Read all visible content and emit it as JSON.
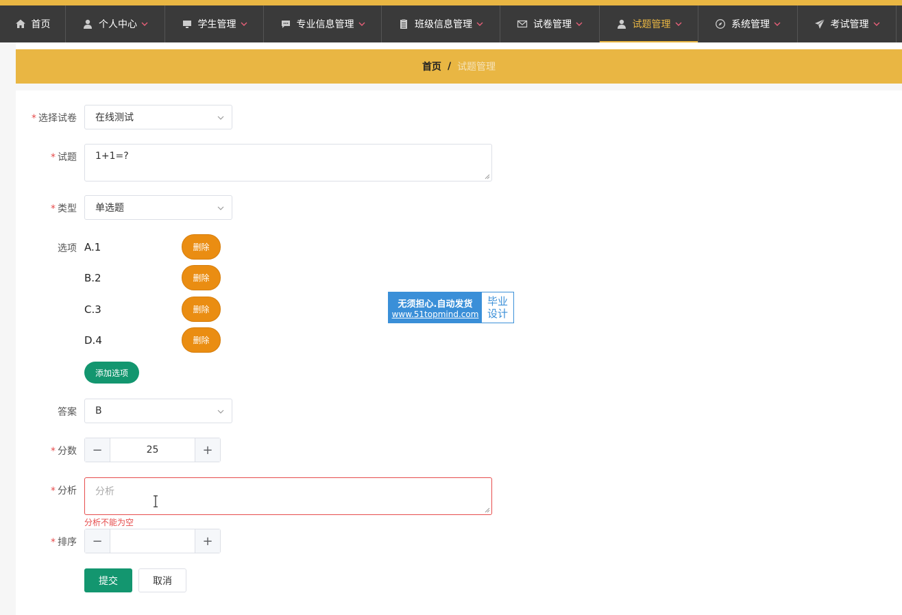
{
  "nav": {
    "items": [
      {
        "label": "首页",
        "icon": "home-icon",
        "has_caret": false,
        "active": false
      },
      {
        "label": "个人中心",
        "icon": "user-icon",
        "has_caret": true,
        "active": false
      },
      {
        "label": "学生管理",
        "icon": "monitor-icon",
        "has_caret": true,
        "active": false
      },
      {
        "label": "专业信息管理",
        "icon": "chat-icon",
        "has_caret": true,
        "active": false
      },
      {
        "label": "班级信息管理",
        "icon": "clipboard-icon",
        "has_caret": true,
        "active": false
      },
      {
        "label": "试卷管理",
        "icon": "mail-icon",
        "has_caret": true,
        "active": false
      },
      {
        "label": "试题管理",
        "icon": "user-icon",
        "has_caret": true,
        "active": true
      },
      {
        "label": "系统管理",
        "icon": "compass-icon",
        "has_caret": true,
        "active": false
      },
      {
        "label": "考试管理",
        "icon": "send-icon",
        "has_caret": true,
        "active": false
      }
    ]
  },
  "breadcrumb": {
    "home": "首页",
    "separator": "/",
    "current": "试题管理"
  },
  "form": {
    "paper": {
      "label": "选择试卷",
      "value": "在线测试"
    },
    "question": {
      "label": "试题",
      "value": "1+1=?"
    },
    "type": {
      "label": "类型",
      "value": "单选题"
    },
    "options": {
      "label": "选项",
      "items": [
        "A.1",
        "B.2",
        "C.3",
        "D.4"
      ],
      "delete_label": "删除",
      "add_label": "添加选项"
    },
    "answer": {
      "label": "答案",
      "value": "B"
    },
    "score": {
      "label": "分数",
      "value": "25"
    },
    "analysis": {
      "label": "分析",
      "placeholder": "分析",
      "error": "分析不能为空"
    },
    "order": {
      "label": "排序",
      "value": ""
    },
    "submit_label": "提交",
    "cancel_label": "取消"
  },
  "watermark": {
    "line1": "无须担心.自动发货",
    "line2": "www.51topmind.com",
    "right1": "毕业",
    "right2": "设计"
  },
  "colors": {
    "accent": "#e9b643",
    "nav_bg": "#3a3a3a",
    "primary": "#13966f",
    "danger_btn": "#ea8d12",
    "error": "#e64b4b"
  }
}
